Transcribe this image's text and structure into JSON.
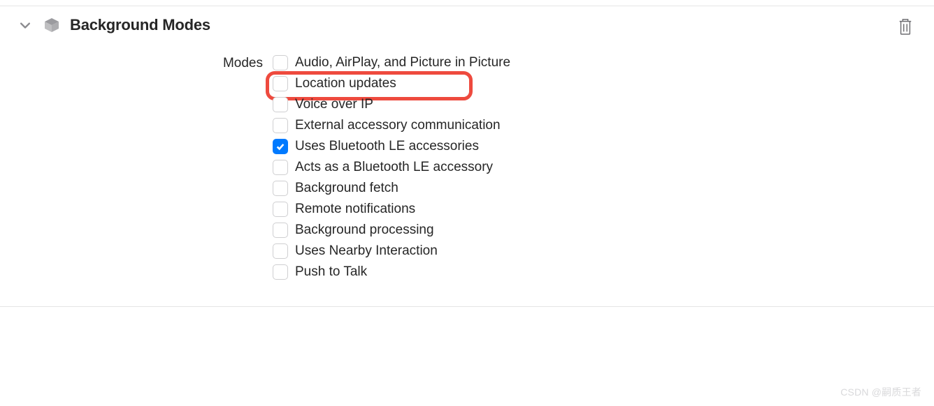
{
  "panel": {
    "title": "Background Modes",
    "modesLabel": "Modes",
    "items": [
      {
        "label": "Audio, AirPlay, and Picture in Picture",
        "checked": false,
        "highlighted": false
      },
      {
        "label": "Location updates",
        "checked": false,
        "highlighted": true
      },
      {
        "label": "Voice over IP",
        "checked": false,
        "highlighted": false
      },
      {
        "label": "External accessory communication",
        "checked": false,
        "highlighted": false
      },
      {
        "label": "Uses Bluetooth LE accessories",
        "checked": true,
        "highlighted": false
      },
      {
        "label": "Acts as a Bluetooth LE accessory",
        "checked": false,
        "highlighted": false
      },
      {
        "label": "Background fetch",
        "checked": false,
        "highlighted": false
      },
      {
        "label": "Remote notifications",
        "checked": false,
        "highlighted": false
      },
      {
        "label": "Background processing",
        "checked": false,
        "highlighted": false
      },
      {
        "label": "Uses Nearby Interaction",
        "checked": false,
        "highlighted": false
      },
      {
        "label": "Push to Talk",
        "checked": false,
        "highlighted": false
      }
    ]
  },
  "watermark": "CSDN @嗣质王者"
}
